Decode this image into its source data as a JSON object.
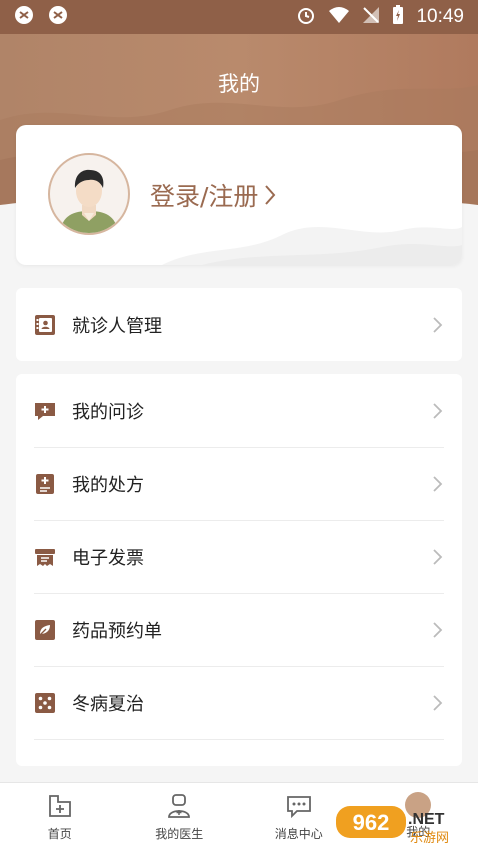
{
  "status_bar": {
    "time": "10:49"
  },
  "page": {
    "title": "我的"
  },
  "login": {
    "label": "登录/注册",
    "chevron": "›"
  },
  "menu_group_1": [
    {
      "label": "就诊人管理",
      "icon": "patient-card-icon"
    }
  ],
  "menu_group_2": [
    {
      "label": "我的问诊",
      "icon": "consultation-icon"
    },
    {
      "label": "我的处方",
      "icon": "prescription-icon"
    },
    {
      "label": "电子发票",
      "icon": "invoice-icon"
    },
    {
      "label": "药品预约单",
      "icon": "medicine-order-icon"
    },
    {
      "label": "冬病夏治",
      "icon": "dice-icon"
    }
  ],
  "tabbar": {
    "tabs": [
      {
        "label": "首页",
        "icon": "home-icon"
      },
      {
        "label": "我的医生",
        "icon": "doctor-icon"
      },
      {
        "label": "消息中心",
        "icon": "message-icon"
      },
      {
        "label": "我的",
        "icon": "profile-icon"
      }
    ]
  },
  "watermark": {
    "text": "962.NET",
    "subtext": "乐游网"
  },
  "colors": {
    "brand": "#9a6a50",
    "header": "#b08468",
    "icon": "#8a5a44"
  }
}
